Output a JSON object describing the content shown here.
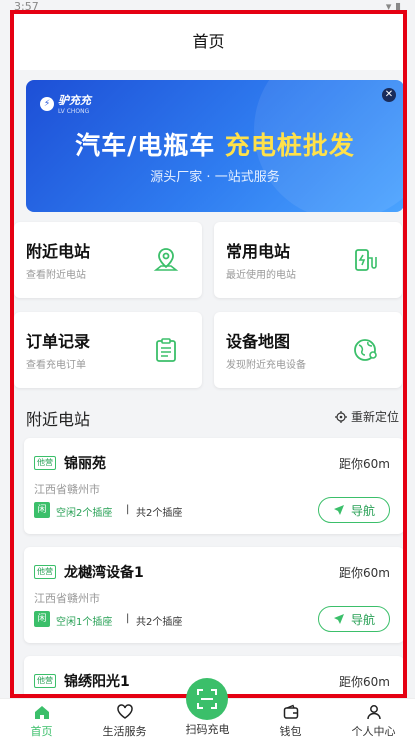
{
  "status_bar": {
    "time": "3:57"
  },
  "header": {
    "title": "首页"
  },
  "banner": {
    "logo": "驴充充",
    "logo_sub": "LV CHONG",
    "title_part1": "汽车/电瓶车 ",
    "title_highlight": "充电桩批发",
    "subtitle": "源头厂家 · 一站式服务"
  },
  "features": [
    {
      "title": "附近电站",
      "subtitle": "查看附近电站",
      "icon": "map-pin-icon"
    },
    {
      "title": "常用电站",
      "subtitle": "最近使用的电站",
      "icon": "charger-icon"
    },
    {
      "title": "订单记录",
      "subtitle": "查看充电订单",
      "icon": "clipboard-icon"
    },
    {
      "title": "设备地图",
      "subtitle": "发现附近充电设备",
      "icon": "globe-pin-icon"
    }
  ],
  "nearby": {
    "title": "附近电站",
    "relocate_label": "重新定位",
    "stations": [
      {
        "tag": "他营",
        "name": "锦丽苑",
        "distance": "距你60m",
        "address": "江西省赣州市",
        "idle_badge": "闲",
        "idle_text": "空闲2个插座",
        "total": "共2个插座",
        "nav_label": "导航"
      },
      {
        "tag": "他营",
        "name": "龙樾湾设备1",
        "distance": "距你60m",
        "address": "江西省赣州市",
        "idle_badge": "闲",
        "idle_text": "空闲1个插座",
        "total": "共2个插座",
        "nav_label": "导航"
      },
      {
        "tag": "他营",
        "name": "锦绣阳光1",
        "distance": "距你60m"
      }
    ]
  },
  "tabbar": {
    "items": [
      {
        "label": "首页",
        "icon": "home-icon",
        "active": true
      },
      {
        "label": "生活服务",
        "icon": "heart-icon",
        "active": false
      },
      {
        "label": "扫码充电",
        "icon": "scan-icon",
        "active": false
      },
      {
        "label": "钱包",
        "icon": "wallet-icon",
        "active": false
      },
      {
        "label": "个人中心",
        "icon": "user-icon",
        "active": false
      }
    ]
  },
  "colors": {
    "accent": "#3bbf6a",
    "frame": "#e50012",
    "banner": "#2f7cf0",
    "highlight": "#ffe14a"
  }
}
